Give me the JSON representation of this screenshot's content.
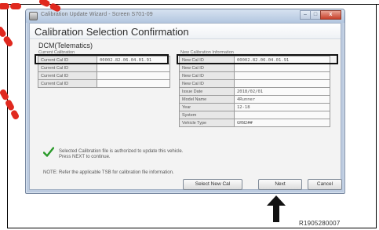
{
  "window": {
    "title": "Calibration Update Wizard - Screen S701-09",
    "buttons": {
      "minimize": "–",
      "maximize": "□",
      "close": "x"
    }
  },
  "heading": "Calibration Selection Confirmation",
  "ecu": "DCM(Telematics)",
  "current": {
    "section_label": "Current Calibration",
    "rows": [
      {
        "label": "Current Cal ID",
        "value": "00002.82.06.04.01.91"
      },
      {
        "label": "Current Cal ID",
        "value": ""
      },
      {
        "label": "Current Cal ID",
        "value": ""
      },
      {
        "label": "Current Cal ID",
        "value": ""
      }
    ]
  },
  "new": {
    "section_label": "New Calibration Information",
    "rows": [
      {
        "label": "New Cal ID",
        "value": "00002.82.06.04.01.91"
      },
      {
        "label": "New Cal ID",
        "value": ""
      },
      {
        "label": "New Cal ID",
        "value": ""
      },
      {
        "label": "New Cal ID",
        "value": ""
      },
      {
        "label": "Issue Date",
        "value": "2018/02/01"
      },
      {
        "label": "Model Name",
        "value": "4Runner"
      },
      {
        "label": "Year",
        "value": "12-18"
      },
      {
        "label": "System",
        "value": ""
      },
      {
        "label": "Vehicle Type",
        "value": "GRN2##"
      }
    ]
  },
  "authorization_message": {
    "line1": "Selected Calibration file is authorized to update this vehicle.",
    "line2": "Press NEXT to continue."
  },
  "note": "NOTE: Refer the applicable TSB for calibration file information.",
  "actions": {
    "select_new_cal": "Select New Cal",
    "next": "Next",
    "cancel": "Cancel"
  },
  "figure_id": "R1905280007",
  "icons": {
    "check": "checkmark-icon",
    "arrow": "up-arrow-icon",
    "app": "app-icon"
  },
  "colors": {
    "check_green": "#2a9a2a",
    "highlight": "#111111",
    "red_mark": "#e0281e"
  }
}
